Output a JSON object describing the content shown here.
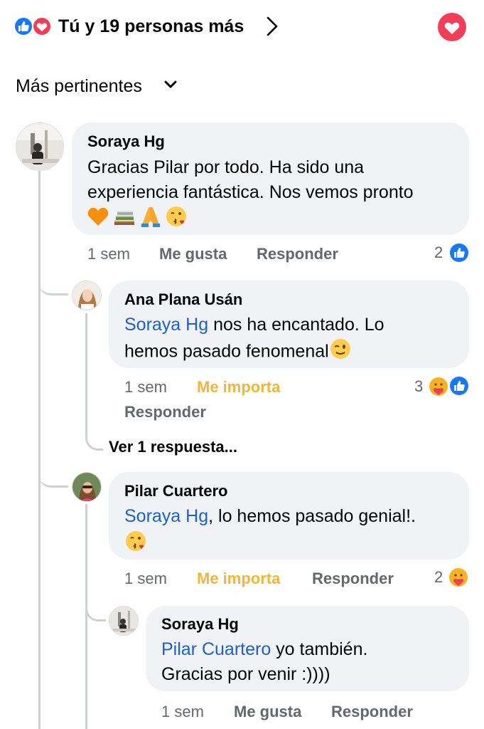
{
  "header": {
    "title": "Tú y 19 personas más"
  },
  "sort": {
    "label": "Más pertinentes"
  },
  "colors": {
    "like_blue": "#1877f2",
    "love_red": "#f33e58",
    "care_yellow": "#f7b125",
    "mention_blue": "#1d61c6",
    "meta_gray": "#65676b",
    "bubble_bg": "#f0f2f5"
  },
  "comments": [
    {
      "author": "Soraya Hg",
      "text_line1": "Gracias Pilar por todo. Ha sido una",
      "text_line2": "experiencia fantástica. Nos vemos pronto",
      "emojis": [
        "orange-heart-icon",
        "books-icon",
        "folded-hands-icon",
        "kiss-face-icon"
      ],
      "time": "1 sem",
      "like_label": "Me gusta",
      "reply_label": "Responder",
      "reaction_count": "2",
      "reactions": [
        "like-icon"
      ]
    },
    {
      "author": "Ana Plana Usán",
      "mention": "Soraya Hg",
      "text_after_mention": " nos ha encantado. Lo",
      "text_line2": "hemos pasado fenomenal",
      "emojis": [
        "wink-face-icon"
      ],
      "time": "1 sem",
      "like_label": "Me importa",
      "reply_label": "Responder",
      "reaction_count": "3",
      "reactions": [
        "care-icon",
        "like-icon"
      ],
      "view_replies": "Ver 1 respuesta..."
    },
    {
      "author": "Pilar Cuartero",
      "mention": "Soraya Hg",
      "text_after_mention": ", lo hemos pasado genial!.",
      "emojis": [
        "kiss-face-icon"
      ],
      "time": "1 sem",
      "like_label": "Me importa",
      "reply_label": "Responder",
      "reaction_count": "2",
      "reactions": [
        "care-icon"
      ]
    },
    {
      "author": "Soraya Hg",
      "mention": "Pilar Cuartero",
      "text_after_mention": " yo también.",
      "text_line2": "Gracias por venir :))))",
      "time": "1 sem",
      "like_label": "Me gusta",
      "reply_label": "Responder"
    }
  ]
}
